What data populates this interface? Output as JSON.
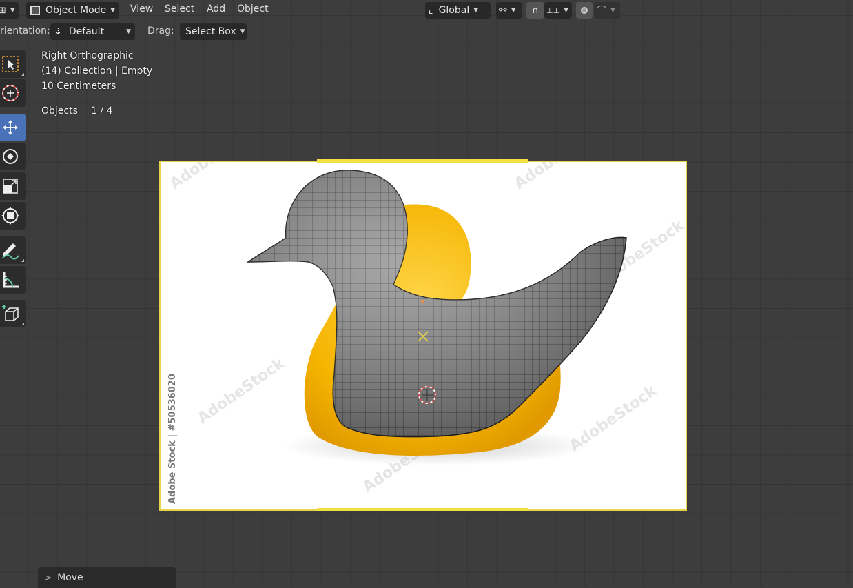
{
  "header": {
    "mode_label": "Object Mode",
    "menus": [
      "View",
      "Select",
      "Add",
      "Object"
    ],
    "transform_orientation": "Global",
    "orientation_label": "rientation:",
    "orientation_value": "Default",
    "drag_label": "Drag:",
    "drag_value": "Select Box"
  },
  "toolbar": {
    "tools": [
      "select-box",
      "cursor",
      "move",
      "rotate",
      "scale",
      "transform",
      "annotate",
      "measure",
      "add-cube"
    ],
    "active_tool": "move",
    "accent": "#4a72b8"
  },
  "overlay": {
    "view_name": "Right Orthographic",
    "collection": "(14) Collection | Empty",
    "scale": "10 Centimeters",
    "objects_label": "Objects",
    "objects_count": "1 / 4"
  },
  "reference_image": {
    "watermark": "Adobe Stock | #50536020",
    "frame_color": "#e8d44a"
  },
  "last_operator": {
    "label": "Move"
  }
}
